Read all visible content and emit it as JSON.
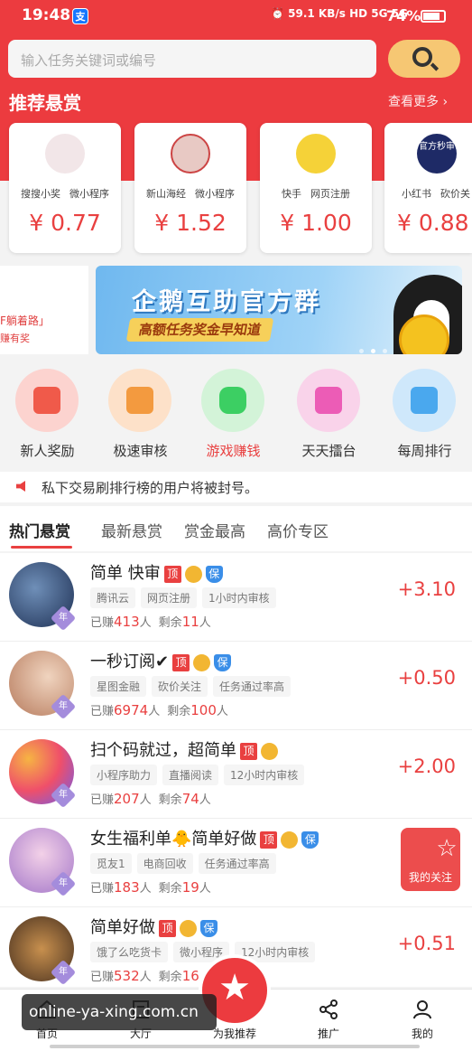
{
  "status": {
    "time": "19:48",
    "app_icon": "支",
    "net_speed": "59.1 KB/s",
    "network": "HD 5G 5G",
    "battery": "74%"
  },
  "search": {
    "placeholder": "输入任务关键词或编号"
  },
  "recommend": {
    "title": "推荐悬赏",
    "more": "查看更多 ›",
    "cards": [
      {
        "tag1": "搜搜小奖",
        "tag2": "微小程序",
        "price": "¥ 0.77",
        "color": "#f2e6e8"
      },
      {
        "tag1": "新山海经",
        "tag2": "微小程序",
        "price": "¥ 1.52",
        "color": "#e8c9c4"
      },
      {
        "tag1": "快手",
        "tag2": "网页注册",
        "price": "¥ 1.00",
        "color": "#f5d238"
      },
      {
        "tag1": "小红书",
        "tag2": "砍价关",
        "price": "¥ 0.88",
        "color": "#1e2a66",
        "avatar_text": "官方秒审"
      }
    ]
  },
  "banner": {
    "left_text": "F躺着路」",
    "left_sub": "赚有奖",
    "title": "企鹅互助官方群",
    "subtitle": "高额任务奖金早知道"
  },
  "categories": [
    {
      "label": "新人奖励",
      "icon": "gift-icon",
      "color": "#fcd3cf",
      "inner": "#f05a4a"
    },
    {
      "label": "极速审核",
      "icon": "document-icon",
      "color": "#fde1c9",
      "inner": "#f39a3f"
    },
    {
      "label": "游戏赚钱",
      "icon": "gamepad-icon",
      "color": "#d3f3d8",
      "inner": "#3ccf63",
      "highlight": true
    },
    {
      "label": "天天擂台",
      "icon": "trophy-icon",
      "color": "#f9d3ea",
      "inner": "#ec5cb6"
    },
    {
      "label": "每周排行",
      "icon": "bar-chart-icon",
      "color": "#cfe8fb",
      "inner": "#4aa8ee"
    }
  ],
  "notice": {
    "text": "私下交易刷排行榜的用户将被封号。"
  },
  "tabs": [
    "热门悬赏",
    "最新悬赏",
    "赏金最高",
    "高价专区"
  ],
  "tasks": [
    {
      "title": "简单 快审",
      "badges": [
        "top",
        "coin",
        "shield"
      ],
      "tags": [
        "腾讯云",
        "网页注册",
        "1小时内审核"
      ],
      "earned_label": "已赚",
      "earned": "413",
      "earned_unit": "人",
      "left_label": "剩余",
      "left": "11",
      "left_unit": "人",
      "amount": "+3.10",
      "avatar_color": "#2d4a7a"
    },
    {
      "title": "一秒订阅✔",
      "badges": [
        "top",
        "coin",
        "shield"
      ],
      "tags": [
        "星图金融",
        "砍价关注",
        "任务通过率高"
      ],
      "earned_label": "已赚",
      "earned": "6974",
      "earned_unit": "人",
      "left_label": "剩余",
      "left": "100",
      "left_unit": "人",
      "amount": "+0.50",
      "avatar_color": "#d9a98a"
    },
    {
      "title": "扫个码就过，超简单",
      "badges": [
        "top",
        "coin"
      ],
      "tags": [
        "小程序助力",
        "直播阅读",
        "12小时内审核"
      ],
      "earned_label": "已赚",
      "earned": "207",
      "earned_unit": "人",
      "left_label": "剩余",
      "left": "74",
      "left_unit": "人",
      "amount": "+2.00",
      "avatar_color": "#f2656b"
    },
    {
      "title": "女生福利单🐥简单好做",
      "badges": [
        "top",
        "coin",
        "shield"
      ],
      "tags": [
        "觅友1",
        "电商回收",
        "任务通过率高"
      ],
      "earned_label": "已赚",
      "earned": "183",
      "earned_unit": "人",
      "left_label": "剩余",
      "left": "19",
      "left_unit": "人",
      "amount": "",
      "avatar_color": "#c9a6d8"
    },
    {
      "title": "简单好做",
      "badges": [
        "top",
        "coin",
        "shield"
      ],
      "tags": [
        "饿了么吃货卡",
        "微小程序",
        "12小时内审核"
      ],
      "earned_label": "已赚",
      "earned": "532",
      "earned_unit": "人",
      "left_label": "剩余",
      "left": "16",
      "left_unit": "",
      "amount": "+0.51",
      "avatar_color": "#6b4a2e"
    }
  ],
  "badge_text": {
    "top": "顶",
    "coin": "",
    "shield": "保"
  },
  "year_badge": "年",
  "follow": {
    "label": "我的关注"
  },
  "nav": {
    "items": [
      "首页",
      "大厅",
      "为我推荐",
      "推广",
      "我的"
    ]
  },
  "watermark": "online-ya-xing.com.cn"
}
